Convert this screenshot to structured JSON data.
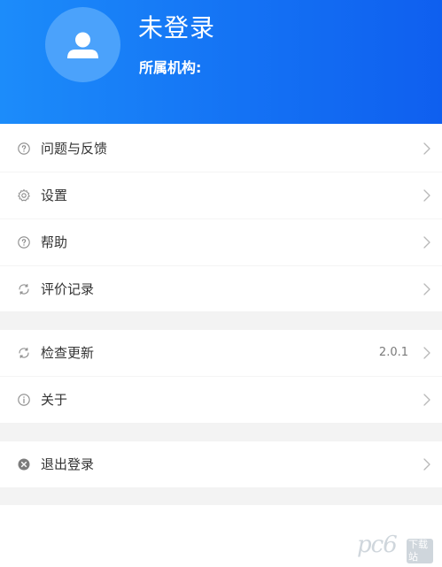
{
  "header": {
    "user_name": "未登录",
    "org_label": "所属机构:"
  },
  "icons": {
    "avatar": "user-icon",
    "feedback": "question-circle-icon",
    "settings": "gear-icon",
    "help": "question-circle-icon",
    "ratings": "refresh-icon",
    "update": "refresh-icon",
    "about": "info-circle-icon",
    "logout": "close-circle-icon",
    "chevron": "chevron-right-icon"
  },
  "menu": {
    "feedback_label": "问题与反馈",
    "settings_label": "设置",
    "help_label": "帮助",
    "ratings_label": "评价记录",
    "update_label": "检查更新",
    "update_version": "2.0.1",
    "about_label": "关于",
    "logout_label": "退出登录"
  },
  "watermark": {
    "text": "pc6",
    "sub": "下载站"
  },
  "colors": {
    "header_start": "#1c8cfa",
    "header_end": "#0f5fef",
    "avatar_bg": "#4ba2fb",
    "text": "#333333",
    "separator": "#f3f3f3"
  }
}
